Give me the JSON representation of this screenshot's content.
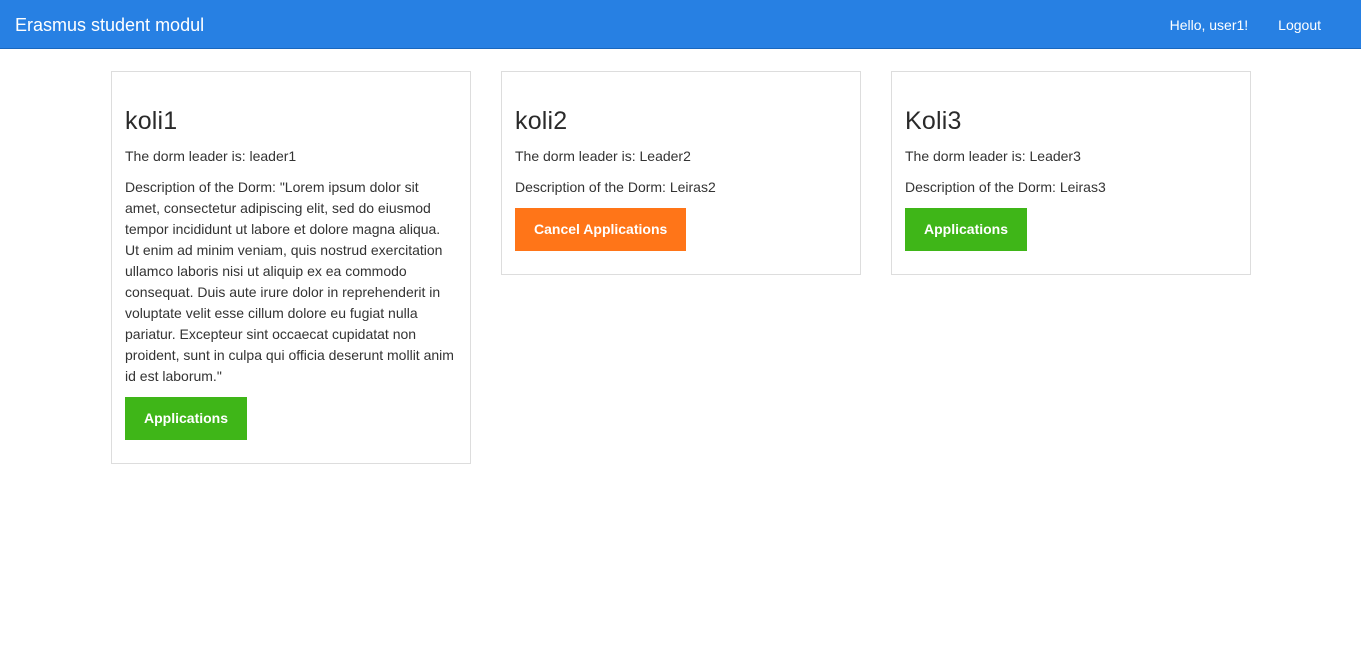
{
  "navbar": {
    "brand": "Erasmus student modul",
    "greeting": "Hello, user1!",
    "logout_label": "Logout",
    "color": "#2780e3"
  },
  "dorms": [
    {
      "name": "koli1",
      "leader_text": "The dorm leader is: leader1",
      "description_text": "Description of the Dorm: \"Lorem ipsum dolor sit amet, consectetur adipiscing elit, sed do eiusmod tempor incididunt ut labore et dolore magna aliqua. Ut enim ad minim veniam, quis nostrud exercitation ullamco laboris nisi ut aliquip ex ea commodo consequat. Duis aute irure dolor in reprehenderit in voluptate velit esse cillum dolore eu fugiat nulla pariatur. Excepteur sint occaecat cupidatat non proident, sunt in culpa qui officia deserunt mollit anim id est laborum.\"",
      "button_label": "Applications",
      "button_color": "#3fb618"
    },
    {
      "name": "koli2",
      "leader_text": "The dorm leader is: Leader2",
      "description_text": "Description of the Dorm: Leiras2",
      "button_label": "Cancel Applications",
      "button_color": "#ff7518"
    },
    {
      "name": "Koli3",
      "leader_text": "The dorm leader is: Leader3",
      "description_text": "Description of the Dorm: Leiras3",
      "button_label": "Applications",
      "button_color": "#3fb618"
    }
  ]
}
